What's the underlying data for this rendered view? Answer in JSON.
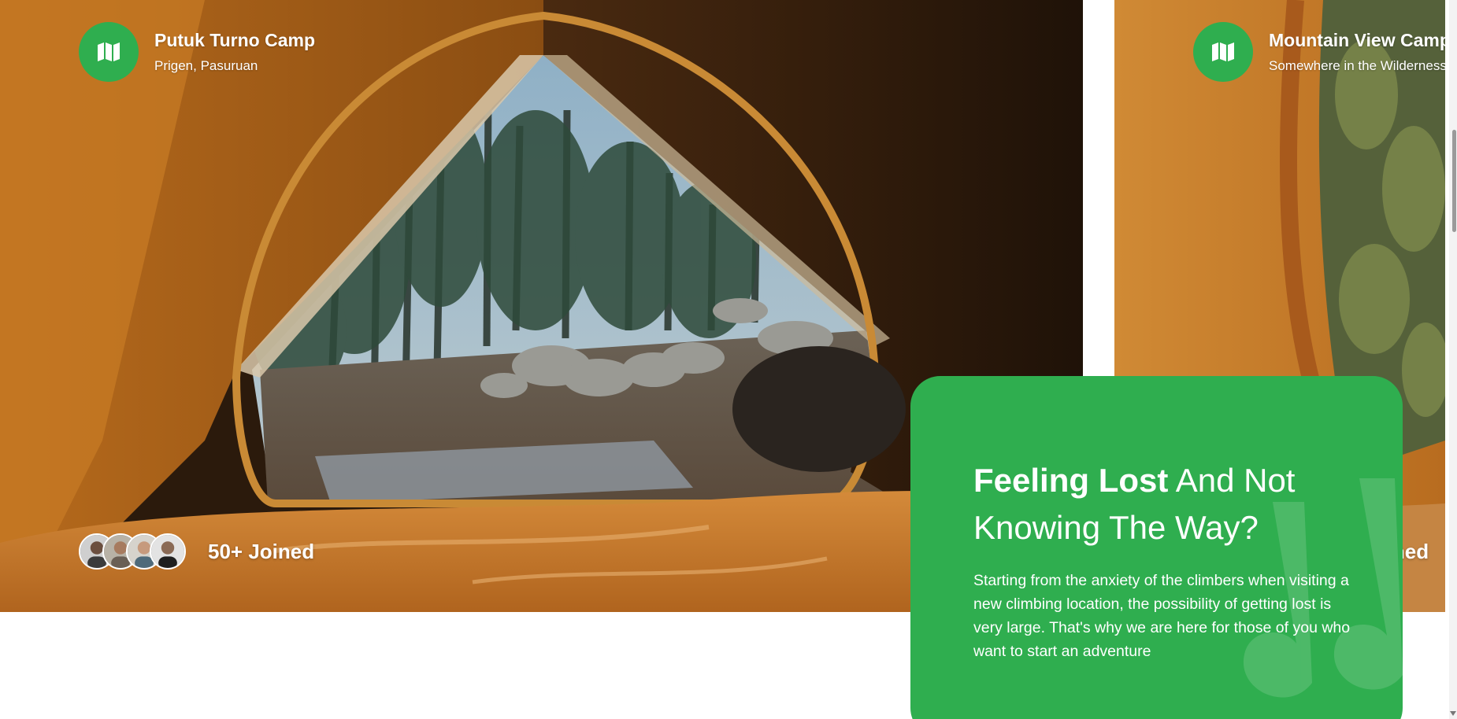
{
  "slides": [
    {
      "title": "Putuk Turno Camp",
      "location": "Prigen, Pasuruan",
      "joined": "50+ Joined",
      "icon": "map-icon"
    },
    {
      "title": "Mountain View Camp",
      "location": "Somewhere in the Wilderness",
      "joined": "50+ Joined",
      "icon": "map-icon"
    }
  ],
  "info": {
    "title_strong": "Feeling Lost",
    "title_rest": " And Not Knowing The Way?",
    "text": "Starting from the anxiety of the climbers when visiting a new climbing location, the possibility of getting lost is very large. That's why we are here for those of you who want to start an adventure"
  },
  "colors": {
    "accent": "#2fae4f",
    "tent_orange": "#c7741f"
  }
}
